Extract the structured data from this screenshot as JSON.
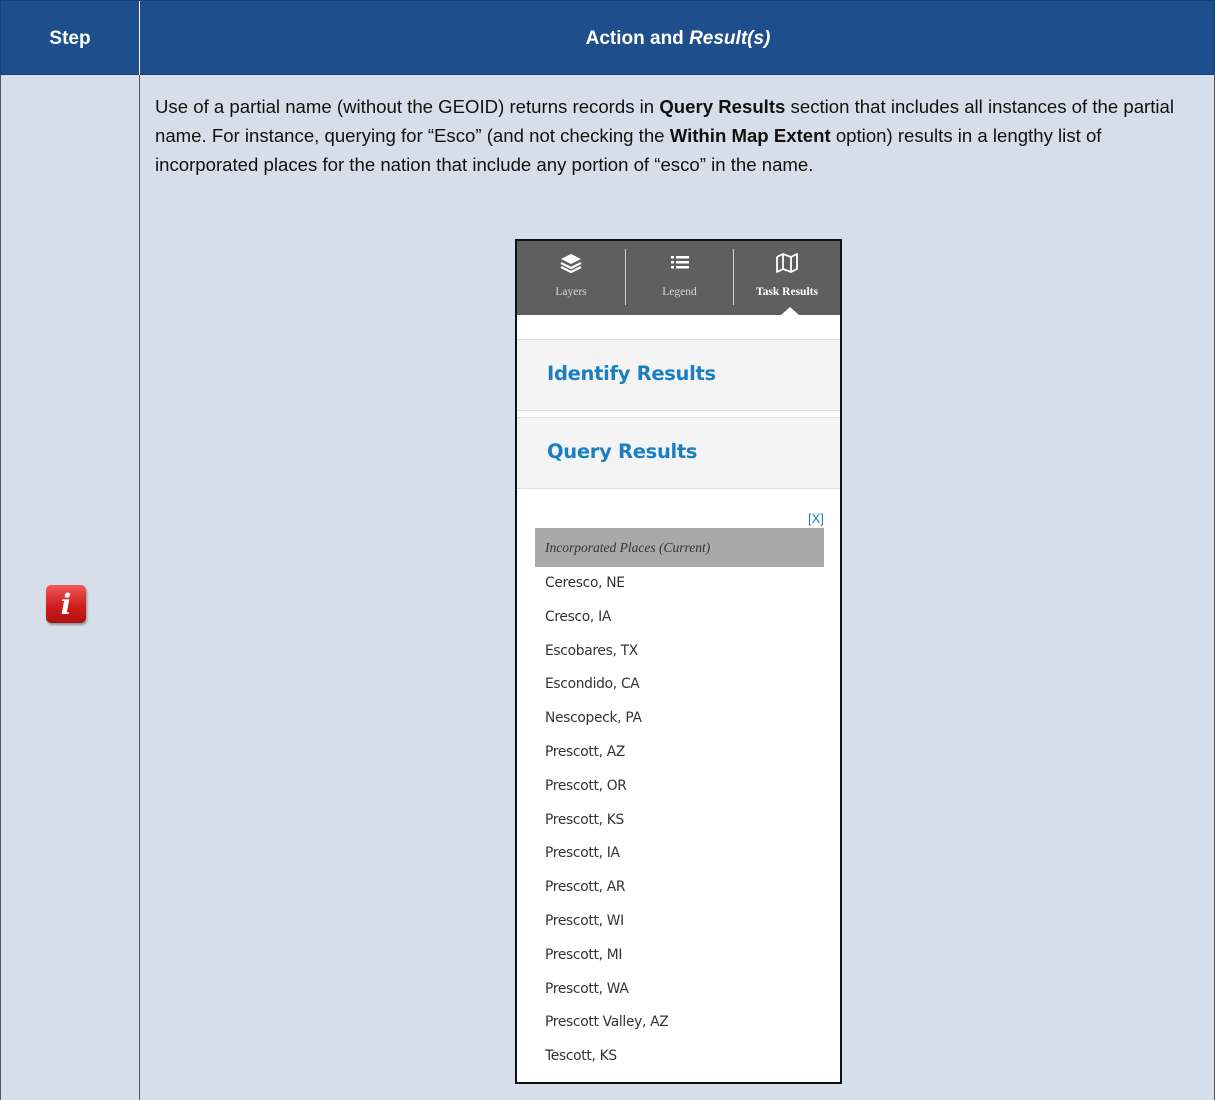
{
  "table": {
    "header": {
      "step_label": "Step",
      "action_label": "Action and ",
      "result_label": "Result(s)"
    },
    "row": {
      "step_icon": "info-icon",
      "step_icon_glyph": "i",
      "paragraph": {
        "p1": "Use of a partial name (without the GEOID) returns records in ",
        "b1": "Query Results",
        "p2": " section that includes all instances of the partial name. For instance, querying for “Esco” (and not checking the ",
        "b2": "Within Map Extent",
        "p3": " option) results in a lengthy list of incorporated places for the nation that include any portion of “esco” in the name."
      }
    }
  },
  "screenshot": {
    "tabs": [
      {
        "label": "Layers",
        "icon": "layers-icon",
        "glyph": "☰"
      },
      {
        "label": "Legend",
        "icon": "legend-icon",
        "glyph": "≡"
      },
      {
        "label": "Task Results",
        "icon": "map-icon",
        "glyph": "▦",
        "active": true
      }
    ],
    "identify_results_title": "Identify Results",
    "query_results_title": "Query Results",
    "close_label": "[X]",
    "group_header": "Incorporated Places (Current)",
    "results": [
      "Ceresco, NE",
      "Cresco, IA",
      "Escobares, TX",
      "Escondido, CA",
      "Nescopeck, PA",
      "Prescott, AZ",
      "Prescott, OR",
      "Prescott, KS",
      "Prescott, IA",
      "Prescott, AR",
      "Prescott, WI",
      "Prescott, MI",
      "Prescott, WA",
      "Prescott Valley, AZ",
      "Tescott, KS"
    ]
  },
  "colors": {
    "header_bg": "#1f4e8c",
    "row_bg": "#d6dfe9",
    "link_blue": "#1a7fc1",
    "tabbar_bg": "#5f5f5f",
    "icon_red": "#d01e1e"
  }
}
